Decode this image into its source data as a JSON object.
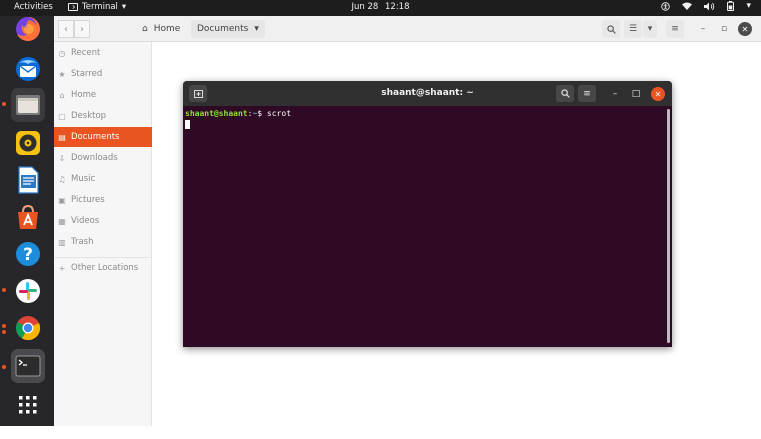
{
  "topbar": {
    "activities": "Activities",
    "app_name": "Terminal",
    "app_menu_arrow": "▾",
    "date": "Jun 28",
    "time": "12:18",
    "tray": {
      "accessibility_icon": "accessibility-icon",
      "network_icon": "wifi-icon",
      "volume_icon": "volume-icon",
      "battery_icon": "battery-icon",
      "menu_arrow": "▾"
    }
  },
  "dock": {
    "apps": [
      {
        "name": "Firefox",
        "icon": "firefox-icon",
        "color": "#e66000"
      },
      {
        "name": "Thunderbird",
        "icon": "thunderbird-icon",
        "color": "#0a84ff"
      },
      {
        "name": "Files",
        "icon": "files-icon",
        "color": "#c8c4bc"
      },
      {
        "name": "Rhythmbox",
        "icon": "rhythmbox-icon",
        "color": "#f6b500"
      },
      {
        "name": "LibreOffice Writer",
        "icon": "writer-icon",
        "color": "#2a78c6"
      },
      {
        "name": "Ubuntu Software",
        "icon": "software-icon",
        "color": "#e95420"
      },
      {
        "name": "Help",
        "icon": "help-icon",
        "color": "#1c8ddb"
      },
      {
        "name": "Slack",
        "icon": "slack-icon",
        "color": "#ffffff"
      },
      {
        "name": "Chrome",
        "icon": "chrome-icon",
        "color": "#4285f4"
      },
      {
        "name": "Terminal",
        "icon": "terminal-icon",
        "color": "#2c2c2c"
      },
      {
        "name": "Show Applications",
        "icon": "app-grid-icon",
        "color": "#ffffff"
      }
    ]
  },
  "files": {
    "breadcrumb": {
      "home": "Home",
      "current": "Documents",
      "arrow": "▾"
    },
    "sidebar": [
      {
        "label": "Recent",
        "icon": "clock-icon",
        "glyph": "◷"
      },
      {
        "label": "Starred",
        "icon": "star-icon",
        "glyph": "★"
      },
      {
        "label": "Home",
        "icon": "home-icon",
        "glyph": "⌂"
      },
      {
        "label": "Desktop",
        "icon": "desktop-icon",
        "glyph": "▢"
      },
      {
        "label": "Documents",
        "icon": "document-icon",
        "glyph": "▤"
      },
      {
        "label": "Downloads",
        "icon": "download-icon",
        "glyph": "⇩"
      },
      {
        "label": "Music",
        "icon": "music-icon",
        "glyph": "♫"
      },
      {
        "label": "Pictures",
        "icon": "pictures-icon",
        "glyph": "▣"
      },
      {
        "label": "Videos",
        "icon": "video-icon",
        "glyph": "▦"
      },
      {
        "label": "Trash",
        "icon": "trash-icon",
        "glyph": "▥"
      },
      {
        "label": "Other Locations",
        "icon": "plus-icon",
        "glyph": "+"
      }
    ],
    "accent": "#e95420"
  },
  "terminal": {
    "title": "shaant@shaant: ~",
    "prompt_user": "shaant@shaant",
    "prompt_sep": ":",
    "prompt_path": "~",
    "prompt_symbol": "$ ",
    "command": "scrot",
    "background": "#2f0a24"
  }
}
